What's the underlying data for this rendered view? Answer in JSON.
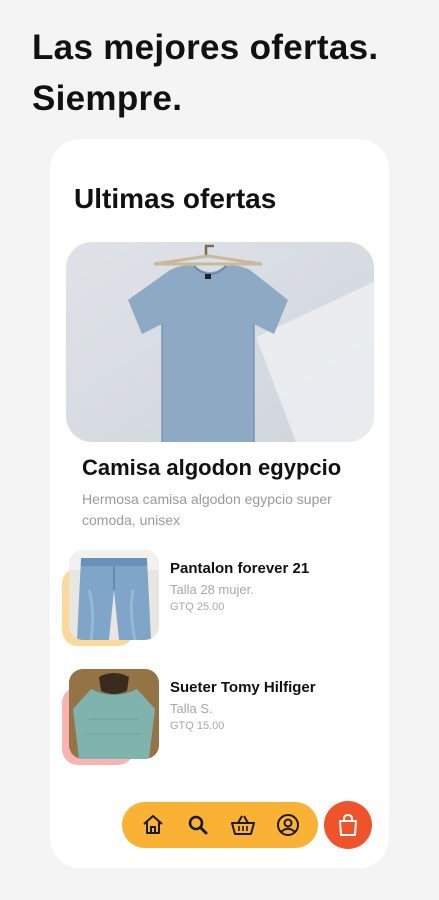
{
  "headline": {
    "line1": "Las mejores ofertas.",
    "line2": "Siempre."
  },
  "section": {
    "title": "Ultimas ofertas"
  },
  "featured": {
    "title": "Camisa algodon egypcio",
    "description": "Hermosa camisa algodon egypcio super comoda, unisex",
    "image_icon": "tshirt-on-hanger"
  },
  "products": [
    {
      "name": "Pantalon forever 21",
      "size": "Talla 28 mujer.",
      "price": "GTQ 25.00",
      "accent": "#fcd89a"
    },
    {
      "name": "Sueter Tomy Hilfiger",
      "size": "Talla S.",
      "price": "GTQ 15.00",
      "accent": "#f9b3b3"
    }
  ],
  "nav": {
    "items": [
      "home-icon",
      "search-icon",
      "basket-icon",
      "profile-icon"
    ],
    "cart_icon": "shopping-bag-icon"
  },
  "colors": {
    "nav_bg": "#f9b233",
    "cart_bg": "#f0522a",
    "page_bg": "#f4f4f4",
    "card_bg": "#ffffff"
  }
}
